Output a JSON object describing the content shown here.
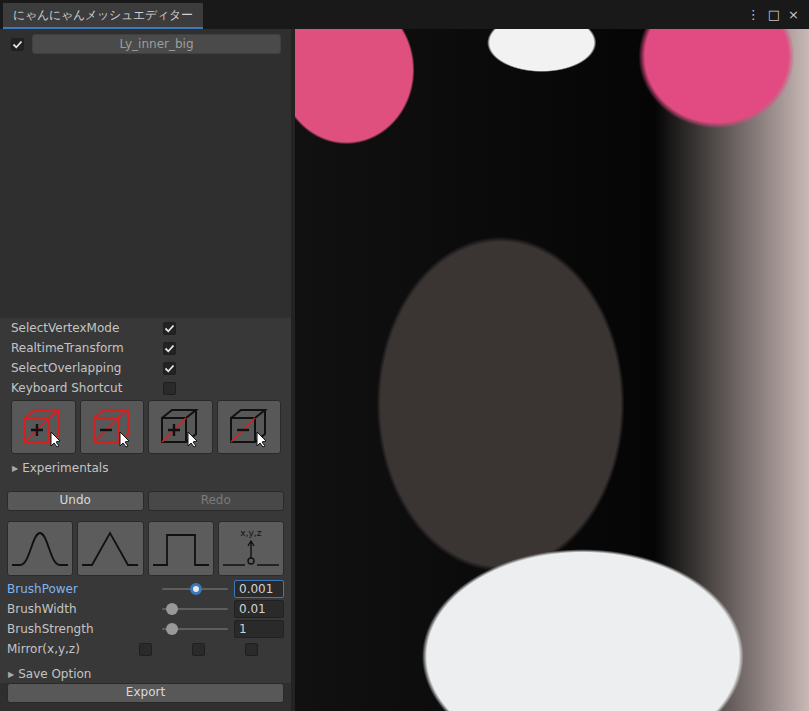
{
  "window": {
    "title": "にゃんにゃんメッシュエディター",
    "controls": [
      "⋮",
      "□",
      "×"
    ]
  },
  "target": {
    "enabled": true,
    "name": "Ly_inner_big"
  },
  "options": [
    {
      "label": "SelectVertexMode",
      "checked": true
    },
    {
      "label": "RealtimeTransform",
      "checked": true
    },
    {
      "label": "SelectOverlapping",
      "checked": true
    },
    {
      "label": "Keyboard Shortcut",
      "checked": false
    }
  ],
  "selectTools": [
    {
      "kind": "add",
      "color": "#d42020"
    },
    {
      "kind": "remove",
      "color": "#d42020"
    },
    {
      "kind": "add",
      "color": "#111111"
    },
    {
      "kind": "remove",
      "color": "#111111"
    }
  ],
  "experimentals": {
    "label": "Experimentals",
    "arrow": "▶",
    "expanded": false
  },
  "history": [
    {
      "label": "Undo",
      "disabled": false
    },
    {
      "label": "Redo",
      "disabled": true
    }
  ],
  "brushShapes": [
    {
      "kind": "smooth",
      "label": ""
    },
    {
      "kind": "linear",
      "label": ""
    },
    {
      "kind": "constant",
      "label": ""
    },
    {
      "kind": "point",
      "label": "x,y,z"
    }
  ],
  "sliders": [
    {
      "label": "BrushPower",
      "level": 0.52,
      "value": "0.001",
      "focused": true
    },
    {
      "label": "BrushWidth",
      "level": 0.15,
      "value": "0.01",
      "focused": false
    },
    {
      "label": "BrushStrength",
      "level": 0.15,
      "value": "1",
      "focused": false
    }
  ],
  "mirror": {
    "label": "Mirror(x,y,z)",
    "axes": [
      {
        "checked": false
      },
      {
        "checked": false
      },
      {
        "checked": false
      }
    ]
  },
  "saveOption": {
    "label": "Save Option",
    "arrow": "▶",
    "expanded": false
  },
  "export": {
    "label": "Export"
  }
}
